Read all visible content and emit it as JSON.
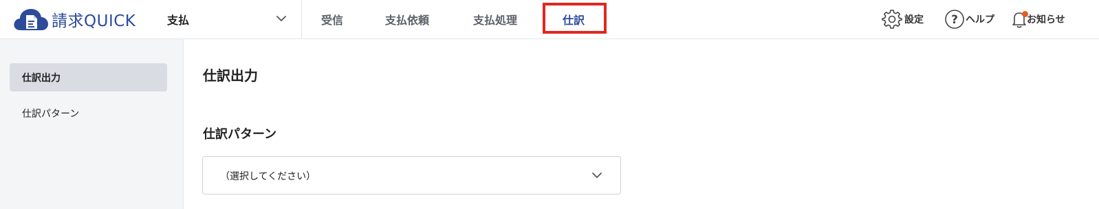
{
  "app": {
    "logo_text": "請求QUICK"
  },
  "header": {
    "context_selector": {
      "label": "支払"
    },
    "nav": [
      {
        "label": "受信",
        "active": false
      },
      {
        "label": "支払依頼",
        "active": false
      },
      {
        "label": "支払処理",
        "active": false
      },
      {
        "label": "仕訳",
        "active": true
      }
    ],
    "utilities": {
      "settings": "設定",
      "help": "ヘルプ",
      "notifications": "お知らせ"
    }
  },
  "sidebar": {
    "items": [
      {
        "label": "仕訳出力",
        "active": true
      },
      {
        "label": "仕訳パターン",
        "active": false
      }
    ]
  },
  "main": {
    "title": "仕訳出力",
    "pattern_section": {
      "label": "仕訳パターン",
      "select_value": "（選択してください）"
    }
  },
  "colors": {
    "brand": "#2c4b9b",
    "highlight": "#e0281f",
    "notification_dot": "#e85a25",
    "sidebar_bg": "#f4f5f7",
    "sidebar_active_bg": "#d9dce2"
  },
  "icons": [
    "cloud-document-logo-icon",
    "chevron-down-icon",
    "gear-icon",
    "help-circle-icon",
    "bell-icon"
  ]
}
